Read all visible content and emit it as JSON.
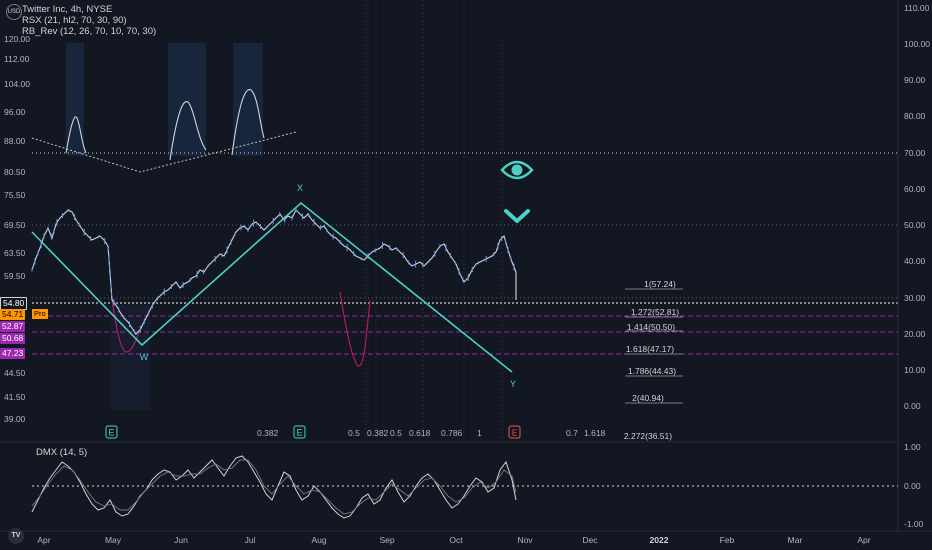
{
  "header": {
    "currency": "USD",
    "symbol_line": "Twitter Inc, 4h, NYSE",
    "indicator_rsx": "RSX (21, hl2, 70, 30, 90)",
    "indicator_rbrev": "RB_Rev (12, 26, 70, 10, 70, 30)"
  },
  "dmx_label": "DMX (14, 5)",
  "price_axis": [
    "120.00",
    "112.00",
    "104.00",
    "96.00",
    "88.00",
    "80.50",
    "75.50",
    "69.50",
    "63.50",
    "59.50",
    "54.80",
    "54.71",
    "52.87",
    "50.68",
    "47.23",
    "44.50",
    "41.50",
    "39.00"
  ],
  "price_badges": [
    {
      "text": "54.80",
      "color": "#ffffff",
      "bg": "#131722"
    },
    {
      "text": "54.71",
      "color": "#000000",
      "bg": "#ff9800"
    },
    {
      "text": "52.87",
      "color": "#ffffff",
      "bg": "#9c27b0"
    },
    {
      "text": "50.68",
      "color": "#ffffff",
      "bg": "#9c27b0"
    },
    {
      "text": "47.23",
      "color": "#ffffff",
      "bg": "#9c27b0"
    }
  ],
  "pro_tag": "Pro",
  "osc_axis": [
    "110.00",
    "100.00",
    "90.00",
    "80.00",
    "70.00",
    "60.00",
    "50.00",
    "40.00",
    "30.00",
    "20.00",
    "10.00",
    "0.00"
  ],
  "dmx_axis": [
    "1.00",
    "0.00",
    "-1.00"
  ],
  "time_axis": [
    "Apr",
    "May",
    "Jun",
    "Jul",
    "Aug",
    "Sep",
    "Oct",
    "Nov",
    "Dec",
    "2022",
    "Feb",
    "Mar",
    "Apr"
  ],
  "fib_levels": [
    "1(57.24)",
    "1.272(52.81)",
    "1.414(50.50)",
    "1.618(47.17)",
    "1.786(44.43)",
    "2(40.94)",
    "2.272(36.51)"
  ],
  "wave_labels": [
    "X",
    "W",
    "Y"
  ],
  "bottom_labels": [
    {
      "text": "0.382",
      "color": "#787b86"
    },
    {
      "text": "0.5",
      "color": "#787b86"
    },
    {
      "text": "0.382",
      "color": "#5b9cf6"
    },
    {
      "text": "0.5",
      "color": "#5b9cf6"
    },
    {
      "text": "0.618",
      "color": "#5b9cf6"
    },
    {
      "text": "0.786",
      "color": "#e040fb"
    },
    {
      "text": "1",
      "color": "#d1d4dc"
    },
    {
      "text": "0.7",
      "color": "#5d606b"
    },
    {
      "text": "1.618",
      "color": "#ff9800"
    }
  ],
  "event_markers": [
    "E",
    "E",
    "E"
  ],
  "colors": {
    "background": "#131722",
    "wave_line": "#4dd0c4",
    "candle": "#d1d4dc",
    "rsx": "#c2185b",
    "fib_dash": "#9c27b0",
    "eye_icon": "#4dd0c4"
  },
  "icons": [
    "eye-icon",
    "chevron-down-icon",
    "tradingview-logo"
  ]
}
